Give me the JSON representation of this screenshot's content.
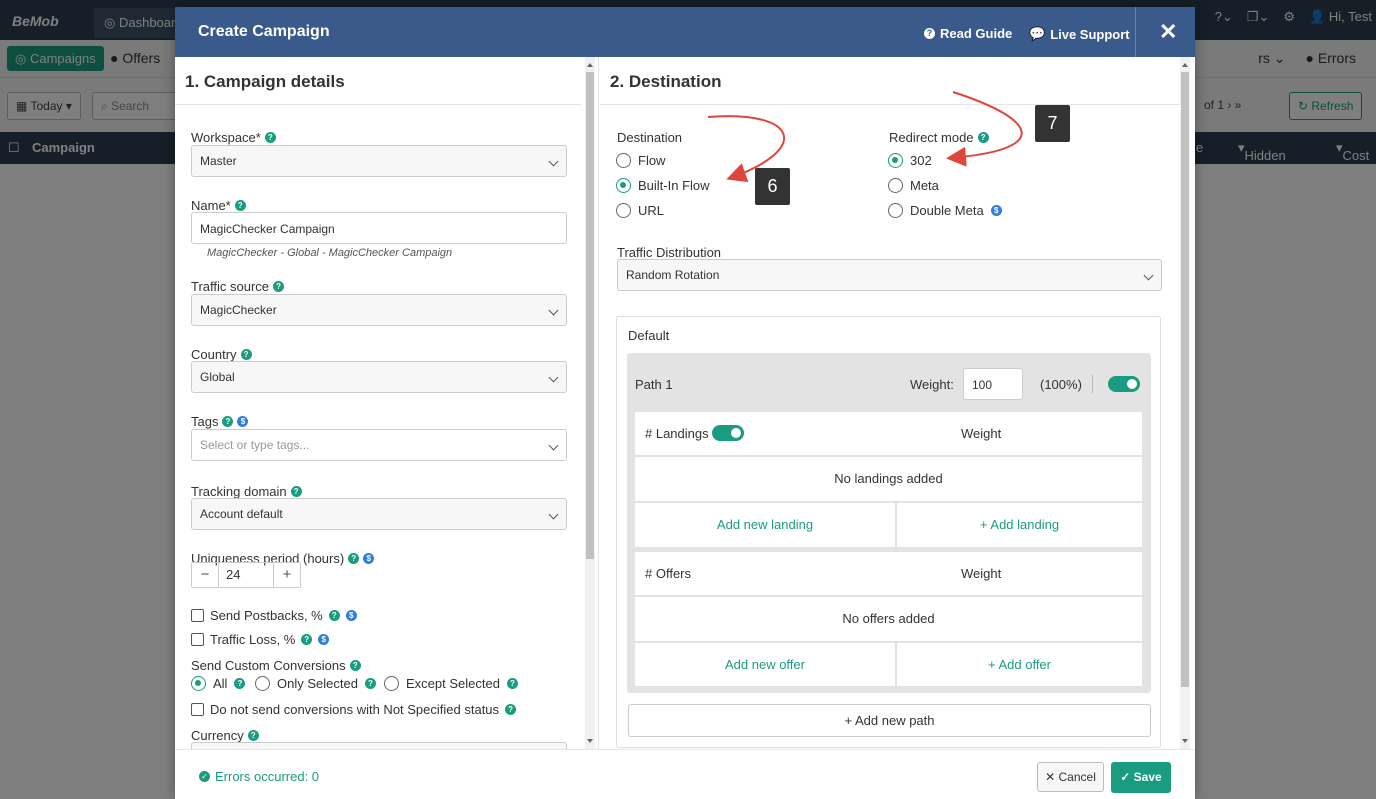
{
  "app": {
    "logo": "BeMob",
    "dashboard_tab": "Dashboard",
    "user_greeting": "Hi, Test",
    "nav": {
      "campaigns": "Campaigns",
      "offers": "Offers",
      "others_partial": "rs",
      "errors": "Errors"
    },
    "toolbar": {
      "date_range": "Today",
      "search_placeholder": "Search",
      "page_of": "of 1",
      "refresh": "Refresh"
    },
    "table_columns": [
      "Campaign",
      "e",
      "Hidden ...",
      "Cost"
    ]
  },
  "modal": {
    "title": "Create Campaign",
    "read_guide": "Read Guide",
    "live_support": "Live Support",
    "close_symbol": "✕"
  },
  "details": {
    "heading": "1. Campaign details",
    "workspace_label": "Workspace*",
    "workspace_value": "Master",
    "name_label": "Name*",
    "name_value": "MagicChecker Campaign",
    "name_hint": "MagicChecker - Global - MagicChecker Campaign",
    "traffic_source_label": "Traffic source",
    "traffic_source_value": "MagicChecker",
    "country_label": "Country",
    "country_value": "Global",
    "tags_label": "Tags",
    "tags_placeholder": "Select or type tags...",
    "tracking_domain_label": "Tracking domain",
    "tracking_domain_value": "Account default",
    "uniqueness_label": "Uniqueness period (hours)",
    "uniqueness_value": "24",
    "send_postbacks_label": "Send Postbacks, %",
    "traffic_loss_label": "Traffic Loss, %",
    "custom_conversions_label": "Send Custom Conversions",
    "conv_options": [
      "All",
      "Only Selected",
      "Except Selected"
    ],
    "not_specified_label": "Do not send conversions with Not Specified status",
    "currency_label": "Currency"
  },
  "destination": {
    "heading": "2. Destination",
    "destination_label": "Destination",
    "dest_options": [
      "Flow",
      "Built-In Flow",
      "URL"
    ],
    "redirect_label": "Redirect mode",
    "redirect_options": [
      "302",
      "Meta",
      "Double Meta"
    ],
    "traffic_dist_label": "Traffic Distribution",
    "traffic_dist_value": "Random Rotation",
    "default_label": "Default",
    "path_name": "Path 1",
    "weight_label": "Weight:",
    "weight_value": "100",
    "weight_pct": "(100%)",
    "landings_label": "# Landings",
    "landings_weight": "Weight",
    "no_landings": "No landings added",
    "add_new_landing": "Add new landing",
    "add_landing": "+ Add landing",
    "offers_label": "# Offers",
    "offers_weight": "Weight",
    "no_offers": "No offers added",
    "add_new_offer": "Add new offer",
    "add_offer": "+ Add offer",
    "add_new_path": "+ Add new path"
  },
  "annotations": {
    "badge_6": "6",
    "badge_7": "7"
  },
  "footer": {
    "errors": "Errors occurred: 0",
    "cancel": "Cancel",
    "save": "Save"
  },
  "colors": {
    "accent": "#1a9c80",
    "header": "#3a5a8c",
    "nav": "#2d3e50",
    "arrow": "#e0453a"
  }
}
